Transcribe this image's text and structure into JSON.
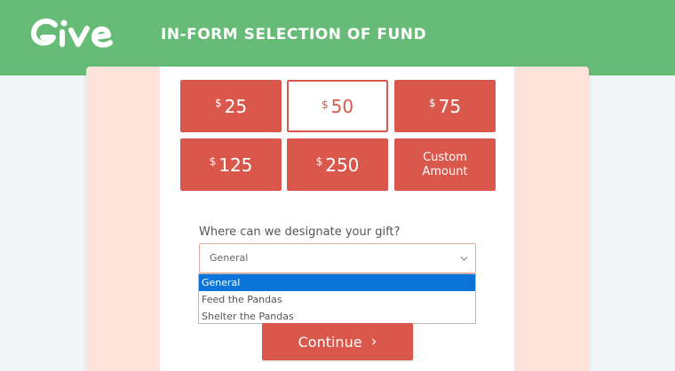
{
  "brand": {
    "logo_text": "Give"
  },
  "header": {
    "title": "IN-FORM SELECTION OF FUND"
  },
  "amounts": [
    {
      "currency": "$",
      "value": "25",
      "selected": false
    },
    {
      "currency": "$",
      "value": "50",
      "selected": true
    },
    {
      "currency": "$",
      "value": "75",
      "selected": false
    },
    {
      "currency": "$",
      "value": "125",
      "selected": false
    },
    {
      "currency": "$",
      "value": "250",
      "selected": false
    }
  ],
  "custom_amount": {
    "line1": "Custom",
    "line2": "Amount"
  },
  "designation": {
    "prompt": "Where can we designate your gift?",
    "selected": "General",
    "options": [
      "General",
      "Feed the Pandas",
      "Shelter the Pandas"
    ],
    "highlighted_index": 0
  },
  "continue": {
    "label": "Continue",
    "icon": "chevron-right-icon"
  },
  "colors": {
    "header_green": "#66bb77",
    "accent_red": "#d9584b",
    "card_pink": "#fde3dc",
    "highlight_blue": "#0a74d8"
  }
}
